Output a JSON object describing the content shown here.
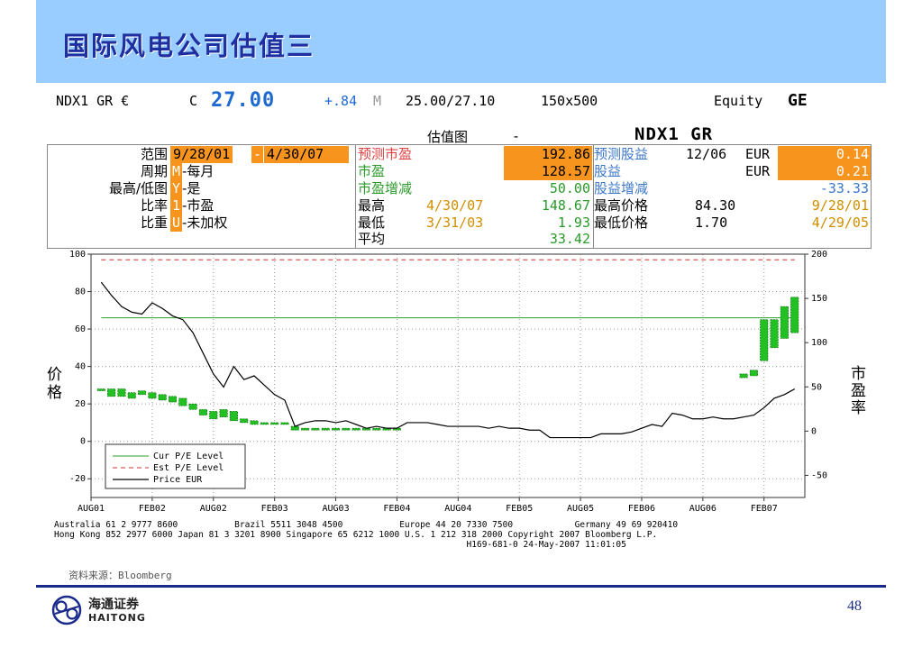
{
  "slide_title": "国际风电公司估值三",
  "ticker_bar": {
    "ticker": "NDX1 GR €",
    "flag": "C",
    "price": "27.00",
    "change": "+.84",
    "mark": "M",
    "range": "25.00/27.10",
    "size": "150x500",
    "type": "Equity",
    "function": "GE"
  },
  "section": {
    "label": "估值图",
    "dash": "-",
    "ticker": "NDX1 GR"
  },
  "panel": {
    "params": [
      {
        "label": "范围",
        "key": "",
        "value": "9/28/01 - 4/30/07"
      },
      {
        "label": "周期",
        "key": "M",
        "value": "-每月"
      },
      {
        "label": "最高/低图",
        "key": "Y",
        "value": "-是"
      },
      {
        "label": "比率",
        "key": "1",
        "value": "-市盈"
      },
      {
        "label": "比重",
        "key": "U",
        "value": "-未加权"
      }
    ],
    "range_start": "9/28/01",
    "range_sep": "-",
    "range_end": "4/30/07",
    "stats": {
      "fwd_pe_label": "预测市盈",
      "fwd_pe": "192.86",
      "pe_label": "市盈",
      "pe": "128.57",
      "pe_chg_label": "市盈增减",
      "pe_chg": "50.00",
      "high_label": "最高",
      "high_date": "4/30/07",
      "high_val": "148.67",
      "low_label": "最低",
      "low_date": "3/31/03",
      "low_val": "1.93",
      "avg_label": "平均",
      "avg_val": "33.42"
    },
    "eps": {
      "fwd_eps_label": "预测股益",
      "fwd_eps_date": "12/06",
      "fwd_eps_cur": "EUR",
      "fwd_eps": "0.14",
      "eps_label": "股益",
      "eps_cur": "EUR",
      "eps": "0.21",
      "eps_chg_label": "股益增减",
      "eps_chg": "-33.33",
      "max_price_label": "最高价格",
      "max_price": "84.30",
      "max_price_date": "9/28/01",
      "min_price_label": "最低价格",
      "min_price": "1.70",
      "min_price_date": "4/29/05"
    }
  },
  "chart_data": {
    "type": "line",
    "y_left": {
      "label": "价格",
      "min": -30,
      "max": 100,
      "ticks": [
        100,
        80,
        60,
        40,
        20,
        0,
        -20
      ]
    },
    "y_right": {
      "label": "市盈率",
      "min": -75,
      "max": 200,
      "ticks": [
        200,
        150,
        100,
        50,
        0,
        -50
      ]
    },
    "x_ticks": [
      "AUG01",
      "FEB02",
      "AUG02",
      "FEB03",
      "AUG03",
      "FEB04",
      "AUG04",
      "FEB05",
      "AUG05",
      "FEB06",
      "AUG06",
      "FEB07"
    ],
    "x_range_months": [
      0,
      70
    ],
    "legend": {
      "position": "bottom-left",
      "items": [
        "Cur P/E Level",
        "Est P/E Level",
        "Price EUR"
      ]
    },
    "cur_pe_level_left": 66,
    "est_pe_level_left": 97,
    "price_eur": [
      [
        1,
        85
      ],
      [
        2,
        78
      ],
      [
        3,
        72
      ],
      [
        4,
        69
      ],
      [
        5,
        68
      ],
      [
        6,
        74
      ],
      [
        7,
        71
      ],
      [
        8,
        67
      ],
      [
        9,
        65
      ],
      [
        10,
        58
      ],
      [
        11,
        47
      ],
      [
        12,
        36
      ],
      [
        13,
        29
      ],
      [
        14,
        40
      ],
      [
        15,
        33
      ],
      [
        16,
        35
      ],
      [
        17,
        30
      ],
      [
        18,
        25
      ],
      [
        19,
        22
      ],
      [
        20,
        8
      ],
      [
        21,
        10
      ],
      [
        22,
        11
      ],
      [
        23,
        11
      ],
      [
        24,
        10
      ],
      [
        25,
        11
      ],
      [
        26,
        9
      ],
      [
        27,
        7
      ],
      [
        28,
        8
      ],
      [
        29,
        7
      ],
      [
        30,
        7
      ],
      [
        31,
        10
      ],
      [
        32,
        10
      ],
      [
        33,
        10
      ],
      [
        34,
        9
      ],
      [
        35,
        8
      ],
      [
        36,
        8
      ],
      [
        37,
        8
      ],
      [
        38,
        8
      ],
      [
        39,
        7
      ],
      [
        40,
        8
      ],
      [
        41,
        7
      ],
      [
        42,
        7
      ],
      [
        43,
        6
      ],
      [
        44,
        6
      ],
      [
        45,
        2
      ],
      [
        46,
        2
      ],
      [
        47,
        2
      ],
      [
        48,
        2
      ],
      [
        49,
        2
      ],
      [
        50,
        4
      ],
      [
        51,
        4
      ],
      [
        52,
        4
      ],
      [
        53,
        5
      ],
      [
        54,
        7
      ],
      [
        55,
        9
      ],
      [
        56,
        8
      ],
      [
        57,
        15
      ],
      [
        58,
        14
      ],
      [
        59,
        12
      ],
      [
        60,
        12
      ],
      [
        61,
        13
      ],
      [
        62,
        12
      ],
      [
        63,
        12
      ],
      [
        64,
        13
      ],
      [
        65,
        14
      ],
      [
        66,
        18
      ],
      [
        67,
        23
      ],
      [
        68,
        25
      ],
      [
        69,
        28
      ]
    ],
    "pe_bars_left": [
      [
        1,
        28,
        27
      ],
      [
        2,
        28,
        24
      ],
      [
        3,
        28,
        24
      ],
      [
        4,
        26,
        23
      ],
      [
        5,
        27,
        25
      ],
      [
        6,
        26,
        23
      ],
      [
        7,
        25,
        22
      ],
      [
        8,
        24,
        21
      ],
      [
        9,
        23,
        19
      ],
      [
        10,
        20,
        17
      ],
      [
        11,
        17,
        14
      ],
      [
        12,
        16,
        12
      ],
      [
        13,
        17,
        13
      ],
      [
        14,
        16,
        11
      ],
      [
        15,
        12,
        10
      ],
      [
        16,
        11,
        9
      ],
      [
        17,
        10,
        9
      ],
      [
        18,
        10,
        9
      ],
      [
        19,
        10,
        9
      ],
      [
        20,
        8,
        6
      ],
      [
        21,
        7,
        6
      ],
      [
        22,
        7,
        6
      ],
      [
        23,
        7,
        6
      ],
      [
        24,
        7,
        6
      ],
      [
        25,
        7,
        6
      ],
      [
        26,
        7,
        6
      ],
      [
        27,
        7,
        6
      ],
      [
        28,
        7,
        6
      ],
      [
        29,
        7,
        6
      ],
      [
        30,
        7,
        6
      ],
      [
        64,
        36,
        34
      ],
      [
        65,
        38,
        35
      ],
      [
        66,
        65,
        43
      ],
      [
        67,
        65,
        50
      ],
      [
        68,
        72,
        55
      ],
      [
        69,
        77,
        58
      ]
    ]
  },
  "contacts": [
    "Australia 61 2 9777 8600           Brazil 5511 3048 4500           Europe 44 20 7330 7500            Germany 49 69 920410",
    "Hong Kong 852 2977 6000 Japan 81 3 3201 8900 Singapore 65 6212 1000 U.S. 1 212 318 2000 Copyright 2007 Bloomberg L.P.",
    "                                                                                H169-681-0 24-May-2007 11:01:05"
  ],
  "source": "资料来源：Bloomberg",
  "logo": {
    "cn": "海通证券",
    "en": "HAITONG"
  },
  "page_number": "48"
}
